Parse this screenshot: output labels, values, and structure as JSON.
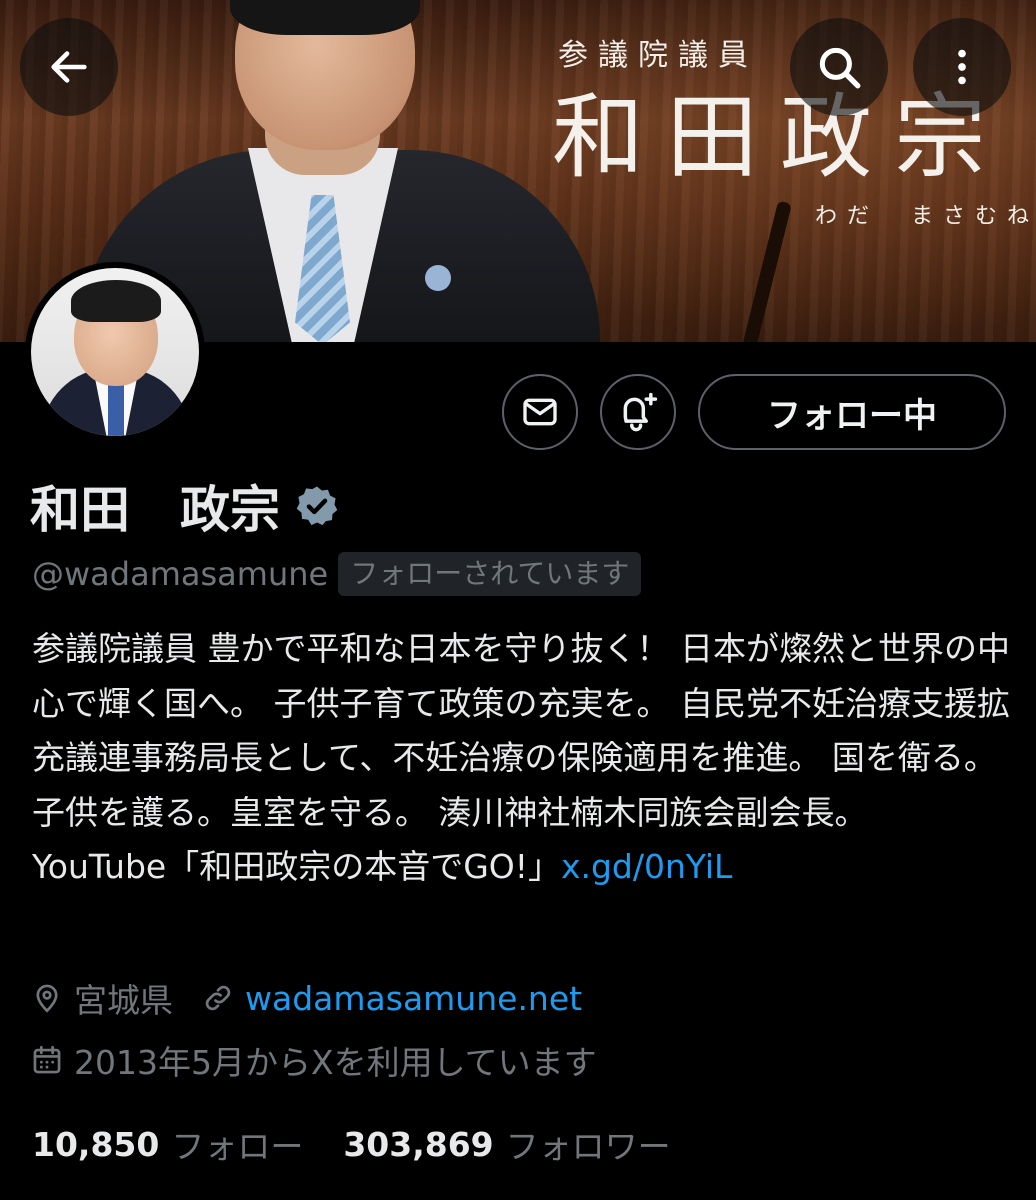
{
  "banner": {
    "title_small": "参議院議員",
    "title_large": "和田政宗",
    "reading": "わだ　まさむね"
  },
  "nav": {
    "back_icon": "arrow-left-icon",
    "search_icon": "search-icon",
    "more_icon": "more-vertical-icon"
  },
  "actions": {
    "message_icon": "envelope-icon",
    "notify_icon": "bell-plus-icon",
    "follow_label": "フォロー中"
  },
  "profile": {
    "display_name": "和田　政宗",
    "verified_icon": "verified-badge-icon",
    "handle": "@wadamasamune",
    "follows_you": "フォローされています",
    "bio_text": "参議院議員 豊かで平和な日本を守り抜く！ 日本が燦然と世界の中心で輝く国へ。 子供子育て政策の充実を。 自民党不妊治療支援拡充議連事務局長として、不妊治療の保険適用を推進。 国を衛る。子供を護る。皇室を守る。 湊川神社楠木同族会副会長。 YouTube「和田政宗の本音でGO!」",
    "bio_link": "x.gd/0nYiL",
    "location": "宮城県",
    "website": "wadamasamune.net",
    "joined": "2013年5月からXを利用しています",
    "following_count": "10,850",
    "following_label": "フォロー",
    "followers_count": "303,869",
    "followers_label": "フォロワー"
  },
  "colors": {
    "background": "#000000",
    "text_primary": "#e7e9ea",
    "text_secondary": "#71767b",
    "link": "#1d9bf0",
    "border": "#5b6166",
    "verified_badge": "#829aab"
  }
}
